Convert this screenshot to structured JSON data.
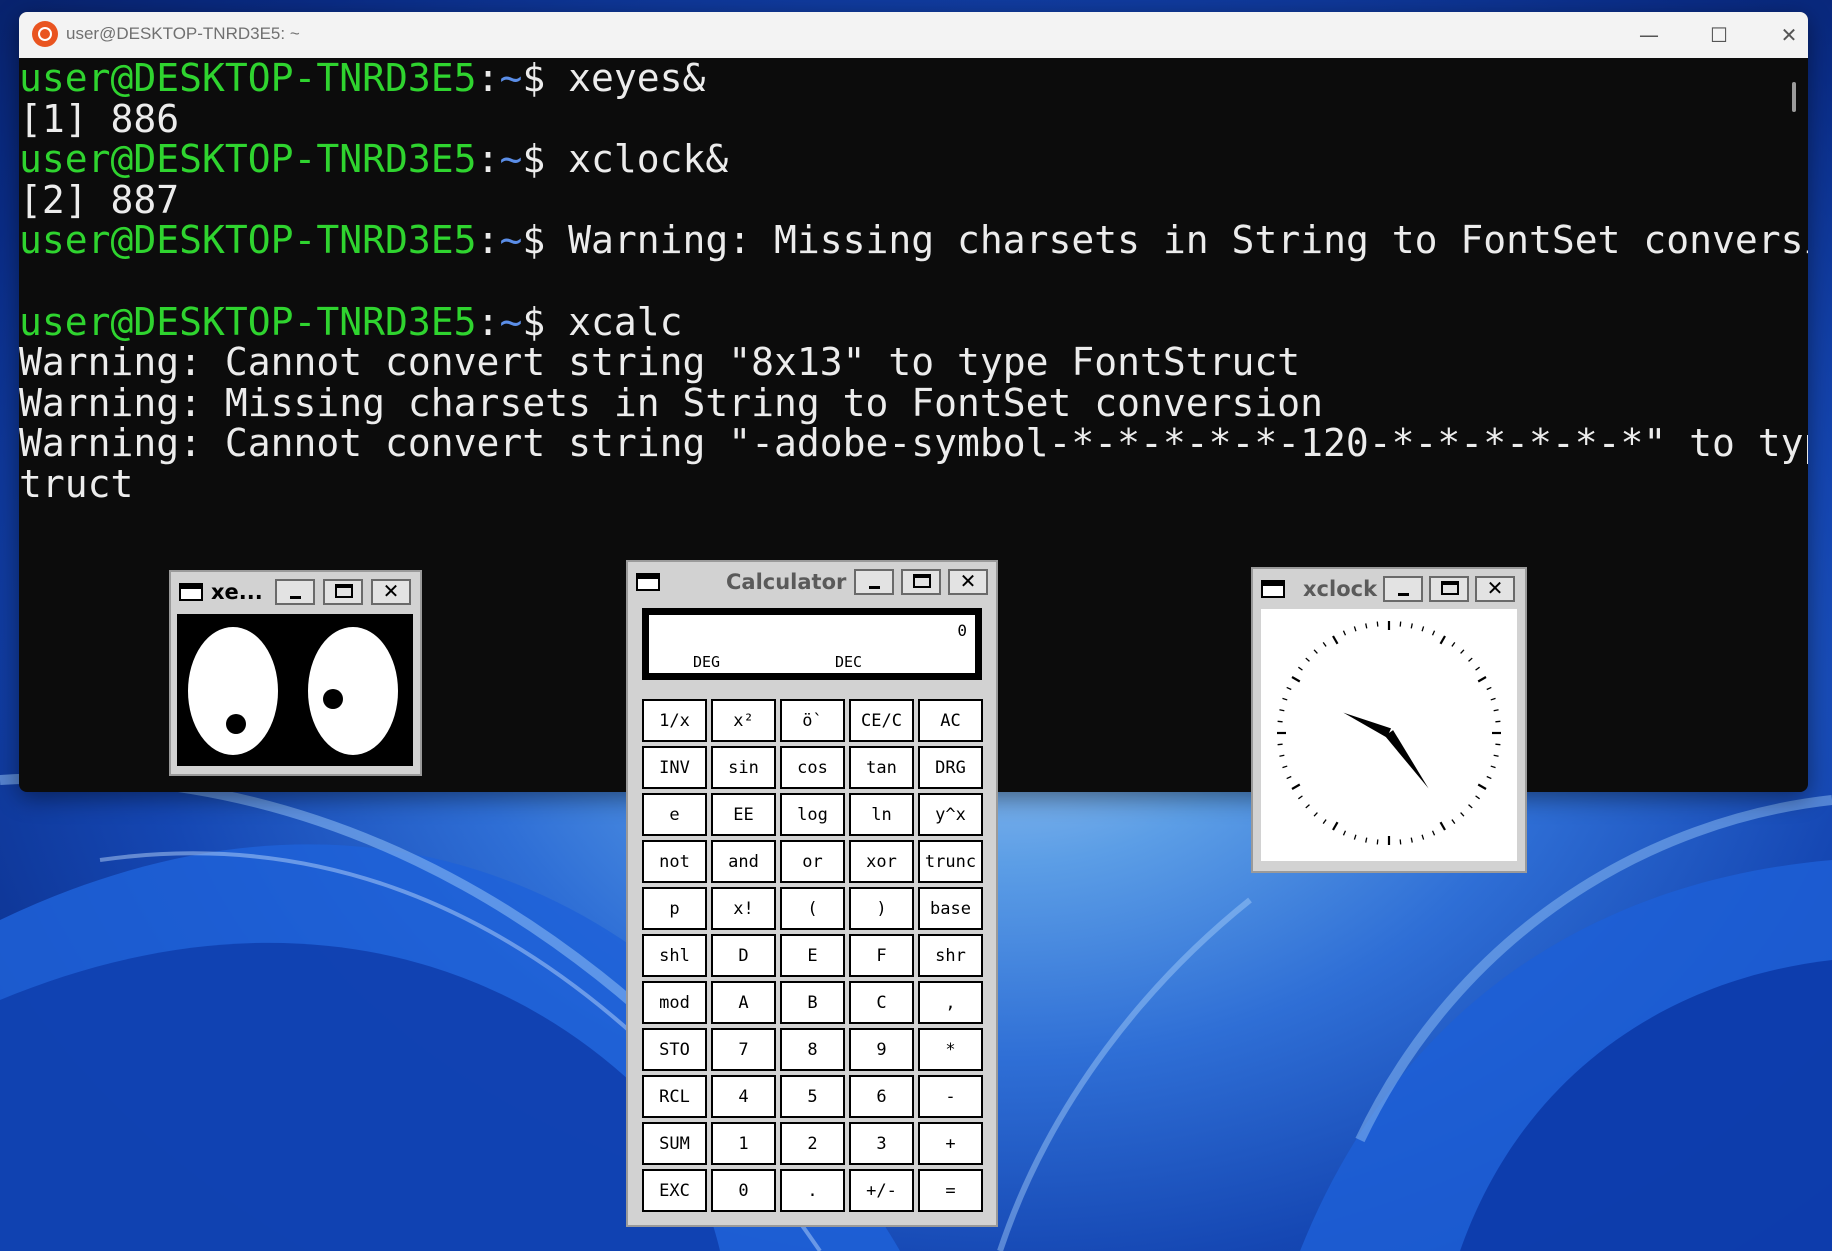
{
  "terminal": {
    "title": "user@DESKTOP-TNRD3E5: ~",
    "window_controls": {
      "minimize": "—",
      "maximize": "☐",
      "close": "✕"
    },
    "lines": [
      {
        "user": "user@DESKTOP-TNRD3E5",
        "sep": ":",
        "path": "~",
        "rest": "$ xeyes&"
      },
      {
        "text": "[1] 886"
      },
      {
        "user": "user@DESKTOP-TNRD3E5",
        "sep": ":",
        "path": "~",
        "rest": "$ xclock&"
      },
      {
        "text": "[2] 887"
      },
      {
        "user": "user@DESKTOP-TNRD3E5",
        "sep": ":",
        "path": "~",
        "rest": "$ Warning: Missing charsets in String to FontSet conversion"
      },
      {
        "text": ""
      },
      {
        "user": "user@DESKTOP-TNRD3E5",
        "sep": ":",
        "path": "~",
        "rest": "$ xcalc"
      },
      {
        "text": "Warning: Cannot convert string \"8x13\" to type FontStruct"
      },
      {
        "text": "Warning: Missing charsets in String to FontSet conversion"
      },
      {
        "text": "Warning: Cannot convert string \"-adobe-symbol-*-*-*-*-*-120-*-*-*-*-*-*\" to type FontS"
      },
      {
        "text": "truct"
      }
    ]
  },
  "xeyes": {
    "title": "xe...",
    "close_label": "✕"
  },
  "xcalc": {
    "title": "Calculator",
    "close_label": "✕",
    "display": {
      "value": "0",
      "angle_mode": "DEG",
      "base_mode": "DEC"
    },
    "keys": [
      [
        "1/x",
        "x²",
        "ö`",
        "CE/C",
        "AC"
      ],
      [
        "INV",
        "sin",
        "cos",
        "tan",
        "DRG"
      ],
      [
        "e",
        "EE",
        "log",
        "ln",
        "y^x"
      ],
      [
        "not",
        "and",
        "or",
        "xor",
        "trunc"
      ],
      [
        "p",
        "x!",
        "(",
        ")",
        "base"
      ],
      [
        "shl",
        "D",
        "E",
        "F",
        "shr"
      ],
      [
        "mod",
        "A",
        "B",
        "C",
        ","
      ],
      [
        "STO",
        "7",
        "8",
        "9",
        "*"
      ],
      [
        "RCL",
        "4",
        "5",
        "6",
        "-"
      ],
      [
        "SUM",
        "1",
        "2",
        "3",
        "+"
      ],
      [
        "EXC",
        "0",
        ".",
        "+/-",
        "="
      ]
    ]
  },
  "xclock": {
    "title": "xclock",
    "close_label": "✕",
    "time_shown": "4:49"
  }
}
